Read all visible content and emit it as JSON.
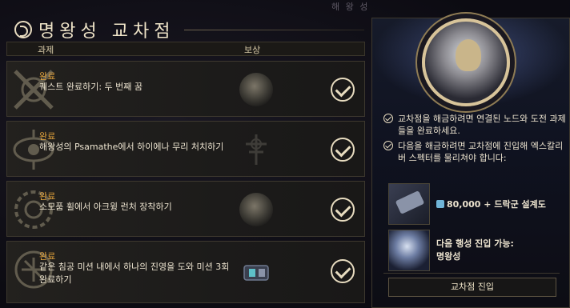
{
  "header": {
    "top_hint": "해 왕 성",
    "title": "명왕성 교차점"
  },
  "columns": {
    "task": "과제",
    "reward": "보상"
  },
  "tasks": [
    {
      "status": "완료",
      "description": "퀘스트 완료하기: 두 번째 꿈"
    },
    {
      "status": "완료",
      "description": "해왕성의 Psamathe에서 하이에나 무리 처치하기"
    },
    {
      "status": "완료",
      "description": "소모품 휠에서 아크윙 런처 장착하기"
    },
    {
      "status": "완료",
      "description": "같은 침공 미션 내에서 하나의 진영을 도와 미션 3회 완료하기"
    }
  ],
  "panel": {
    "info1": "교차점을 해금하려면 연결된 노드와 도전 과제들을 완료하세요.",
    "info2": "다음을 해금하려면 교차점에 진입해 엑스칼리버 스펙터를 물리쳐야 합니다:",
    "reward1": "80,000 + 드락군 설계도",
    "reward2_title": "다음 행성 진입 가능:",
    "reward2_value": "명왕성",
    "enter_button": "교차점 진입"
  }
}
